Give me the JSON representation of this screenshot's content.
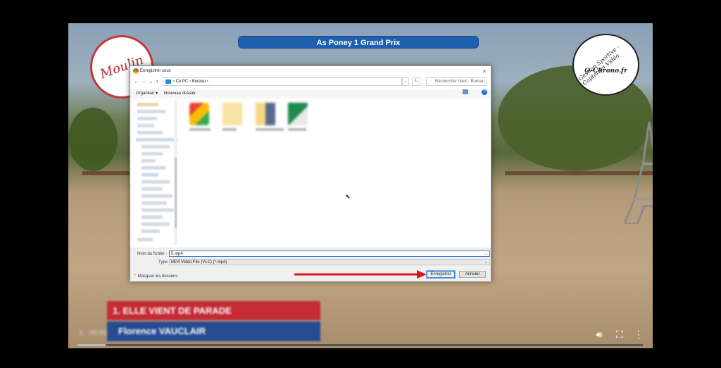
{
  "video": {
    "event_title": "As Poney 1 Grand Prix",
    "logo_left_text": "Moulin",
    "logo_right_text": "O-Chrono.fr",
    "logo_right_tagline": "Gestion Sportive - Captation Vidéo",
    "lower_third_top": "1. ELLE VIENT DE PARADE",
    "lower_third_bottom": "Florence VAUCLAIR",
    "player_left_text": "1 · 00:00",
    "progress": 0.05
  },
  "dialog": {
    "title": "Enregistrer sous",
    "close": "×",
    "nav": {
      "back": "←",
      "forward": "→",
      "down": "⌄",
      "up": "↑"
    },
    "breadcrumb": [
      "Ce PC",
      "Bureau"
    ],
    "breadcrumb_sep": "›",
    "search_placeholder": "Rechercher dans : Bureau",
    "toolbar": {
      "organize": "Organiser ▾",
      "new_folder": "Nouveau dossier",
      "help": "?"
    },
    "filename_label": "Nom du fichier :",
    "filename_value": "5.mp4",
    "type_label": "Type :",
    "type_value": "MP4 Video File (VLC) (*.mp4)",
    "hide_folders": "Masquer les dossiers",
    "save_label": "Enregistrer",
    "cancel_label": "Annuler"
  },
  "colors": {
    "accent": "#1f5fb0",
    "arrow": "#e0141e",
    "lower_third_red": "#c42b33",
    "lower_third_blue": "#274b92"
  }
}
